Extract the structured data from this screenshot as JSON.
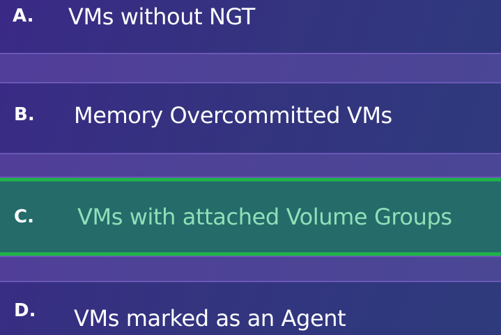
{
  "options": [
    {
      "letter": "A.",
      "text": "VMs without NGT",
      "selected": false
    },
    {
      "letter": "B.",
      "text": "Memory Overcommitted VMs",
      "selected": false
    },
    {
      "letter": "C.",
      "text": "VMs with attached Volume Groups",
      "selected": true
    },
    {
      "letter": "D.",
      "text": "VMs marked as an Agent",
      "selected": false
    }
  ],
  "colors": {
    "background": "#34337f",
    "separator_band": "#5a3f9e",
    "selected_fill": "#246b6a",
    "selected_border": "#1fb24a",
    "selected_text": "#8fe0b8",
    "text": "#ffffff"
  }
}
